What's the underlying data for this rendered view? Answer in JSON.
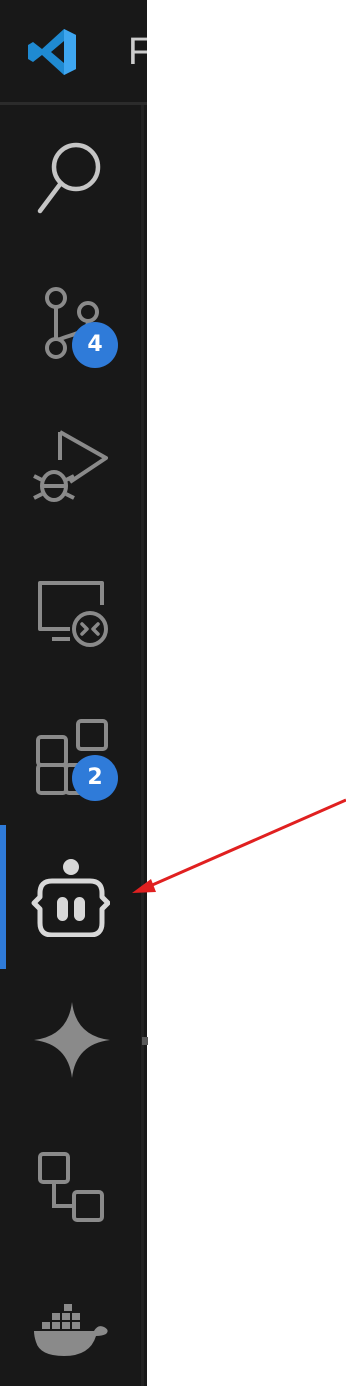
{
  "app": {
    "title_fragment": "F",
    "logo_icon": "vscode-logo-icon",
    "brand_color": "#2f7bd9"
  },
  "activity_bar": {
    "background": "#181818",
    "active_indicator_color": "#2f7bd9",
    "items": [
      {
        "name": "search",
        "icon": "search-icon",
        "badge": ""
      },
      {
        "name": "source-control",
        "icon": "source-control-icon",
        "badge": "4"
      },
      {
        "name": "run-and-debug",
        "icon": "run-debug-icon",
        "badge": ""
      },
      {
        "name": "remote-explorer",
        "icon": "remote-explorer-icon",
        "badge": ""
      },
      {
        "name": "extensions",
        "icon": "extensions-icon",
        "badge": "2"
      },
      {
        "name": "copilot-chat",
        "icon": "robot-icon",
        "badge": "",
        "active": true
      },
      {
        "name": "gemini",
        "icon": "sparkle-icon",
        "badge": ""
      },
      {
        "name": "workflow",
        "icon": "flow-icon",
        "badge": ""
      },
      {
        "name": "docker",
        "icon": "docker-icon",
        "badge": ""
      }
    ]
  },
  "annotation": {
    "type": "red-arrow",
    "color": "#e02020",
    "points_to": "copilot-chat"
  }
}
